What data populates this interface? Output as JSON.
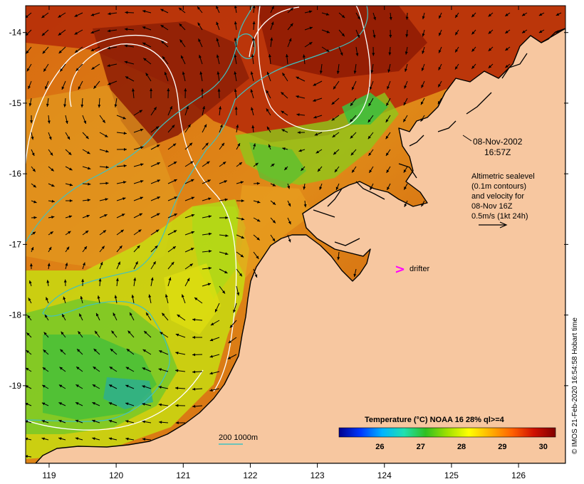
{
  "map": {
    "lon_range": [
      118.65,
      126.7
    ],
    "lat_range": [
      -20.1,
      -13.62
    ],
    "lon_ticks": [
      {
        "value": 119,
        "label": "119"
      },
      {
        "value": 120,
        "label": "120"
      },
      {
        "value": 121,
        "label": "121"
      },
      {
        "value": 122,
        "label": "122"
      },
      {
        "value": 123,
        "label": "123"
      },
      {
        "value": 124,
        "label": "124"
      },
      {
        "value": 125,
        "label": "125"
      },
      {
        "value": 126,
        "label": "126"
      }
    ],
    "lat_ticks": [
      {
        "value": -14,
        "label": "-14"
      },
      {
        "value": -15,
        "label": "-15"
      },
      {
        "value": -16,
        "label": "-16"
      },
      {
        "value": -17,
        "label": "-17"
      },
      {
        "value": -18,
        "label": "-18"
      },
      {
        "value": -19,
        "label": "-19"
      }
    ],
    "colors": {
      "land": "#f7c7a0",
      "coast": "#000000",
      "isobath": "#3fc2c2",
      "contour": "#ffffff",
      "drifter": "#ff00ff"
    }
  },
  "annotations": {
    "date_line1": "08-Nov-2002",
    "date_line2": "16:57Z",
    "alt_line1": "Altimetric sealevel",
    "alt_line2": "(0.1m contours)",
    "alt_line3": "and velocity for",
    "alt_line4": "08-Nov 16Z",
    "alt_line5": "0.5m/s (1kt 24h)",
    "drifter_symbol": ">",
    "drifter_label": "drifter",
    "isobath_label": "200  1000m"
  },
  "colorbar": {
    "title": "Temperature (°C) NOAA 16 28% ql>=4",
    "vmin": 25,
    "vmax": 30.3,
    "labels": [
      "26",
      "27",
      "28",
      "29",
      "30"
    ],
    "label_values": [
      26,
      27,
      28,
      29,
      30
    ],
    "colors": [
      "#00008f",
      "#0038ff",
      "#00b4ff",
      "#20e0b0",
      "#30c020",
      "#a0e000",
      "#ffff00",
      "#ffb000",
      "#ff6000",
      "#d01000",
      "#800000"
    ]
  },
  "credit": "© IMOS 21-Feb-2020 16:54:58 Hobart time"
}
